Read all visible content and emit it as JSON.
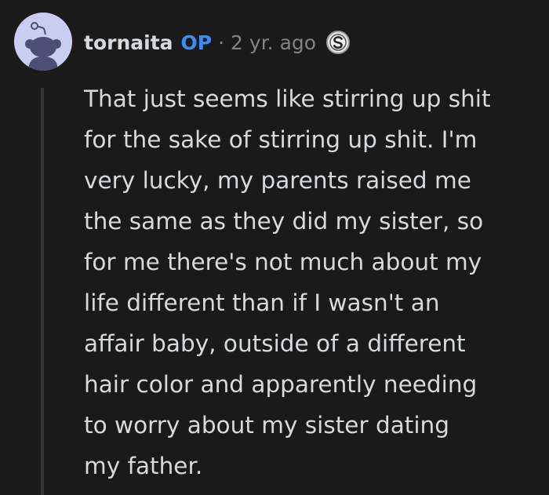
{
  "comment": {
    "author": "tornaita",
    "op_label": "OP",
    "separator": "·",
    "timestamp": "2 yr. ago",
    "avatar_icon": "snoo-avatar-icon",
    "award_icon": "silver-award-icon",
    "body_lines": [
      "That just seems like stirring up shit",
      "for the sake of stirring up shit. I'm",
      "very lucky, my parents raised me",
      "the same as they did my sister, so",
      "for me there's not much about my",
      "life different than if I wasn't an",
      "affair baby, outside of a different",
      "hair color and apparently needing",
      "to worry about my sister dating",
      "my father."
    ]
  },
  "colors": {
    "background": "#1a1a1b",
    "text": "#d7dadc",
    "muted": "#818384",
    "op_blue": "#3d8ef0",
    "avatar_bg": "#c9cdf0",
    "thread_line": "#343536"
  }
}
